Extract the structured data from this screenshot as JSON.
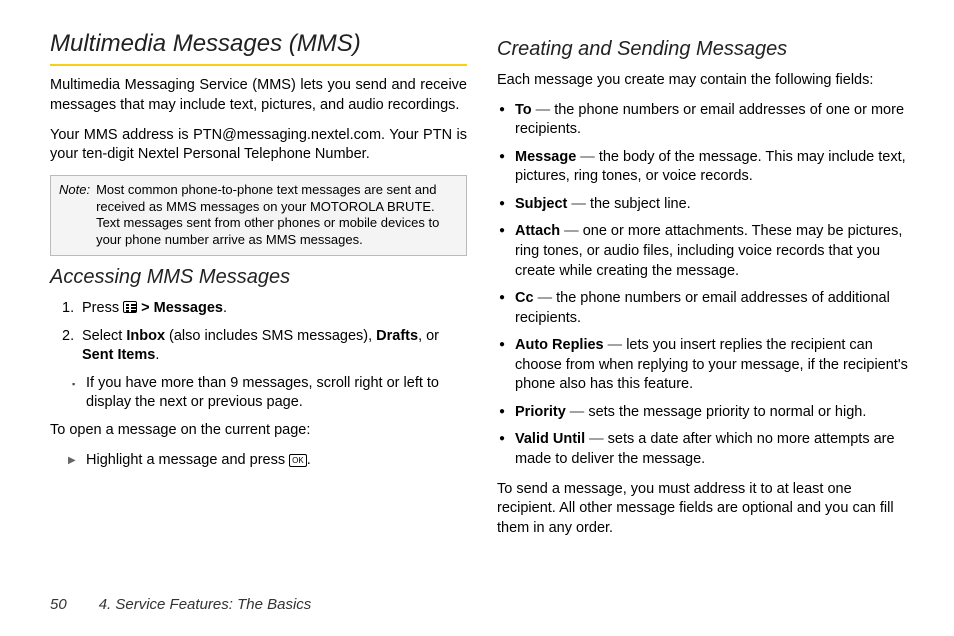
{
  "left": {
    "h1": "Multimedia Messages (MMS)",
    "p1": "Multimedia Messaging Service (MMS) lets you send and receive messages that may include text, pictures, and audio recordings.",
    "p2": "Your MMS address is PTN@messaging.nextel.com. Your PTN is your ten-digit Nextel Personal Telephone Number.",
    "note_label": "Note:",
    "note_text": "Most common phone-to-phone text messages are sent and received as MMS messages on your MOTOROLA BRUTE. Text messages sent from other phones or mobile devices to your phone number arrive as MMS messages.",
    "h2": "Accessing MMS Messages",
    "step1_a": "Press ",
    "step1_b": " > ",
    "step1_c": "Messages",
    "step1_d": ".",
    "step2_a": "Select ",
    "step2_b": "Inbox",
    "step2_c": " (also includes SMS messages), ",
    "step2_d": "Drafts",
    "step2_e": ", or ",
    "step2_f": "Sent Items",
    "step2_g": ".",
    "sub1": "If you have more than 9 messages, scroll right or left to display the next or previous page.",
    "open_p": "To open a message on the current page:",
    "arrow1_a": "Highlight a message and press ",
    "arrow1_b": "."
  },
  "right": {
    "h2": "Creating and Sending Messages",
    "intro": "Each message you create may contain the following fields:",
    "fields": [
      {
        "label": "To",
        "text": "the phone numbers or email addresses of one or more recipients."
      },
      {
        "label": "Message",
        "text": "the body of the message. This may include text, pictures, ring tones, or voice records."
      },
      {
        "label": "Subject",
        "text": "the subject line."
      },
      {
        "label": "Attach",
        "text": "one or more attachments. These may be pictures, ring tones, or audio files, including voice records that you create while creating the message."
      },
      {
        "label": "Cc",
        "text": "the phone numbers or email addresses of additional recipients."
      },
      {
        "label": "Auto Replies",
        "text": "lets you insert replies the recipient can choose from when replying to your message, if the recipient's phone also has this feature."
      },
      {
        "label": "Priority",
        "text": "sets the message priority to normal or high."
      },
      {
        "label": "Valid Until",
        "text": "sets a date after which no more attempts are made to deliver the message."
      }
    ],
    "outro": "To send a message, you must address it to at least one recipient. All other message fields are optional and you can fill them in any order."
  },
  "footer": {
    "page": "50",
    "chapter": "4. Service Features: The Basics"
  },
  "glyphs": {
    "ok": "OK"
  }
}
